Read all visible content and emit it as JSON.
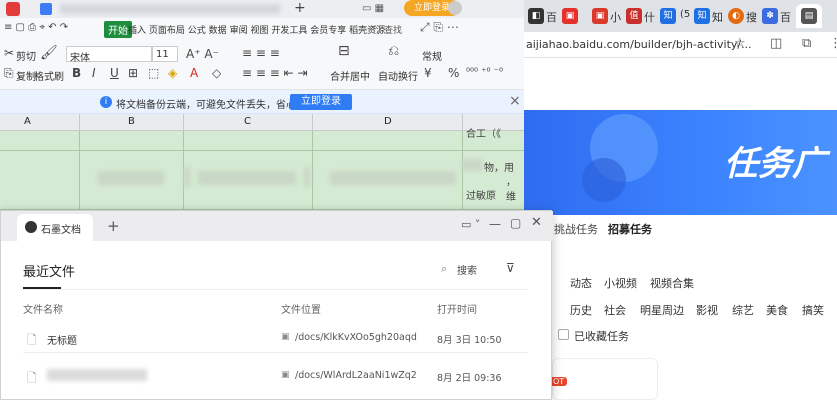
{
  "wps": {
    "tab_title_blurred": "",
    "add_tab": "+",
    "login_button": "立即登录",
    "menu": {
      "start_label": "开始",
      "items": [
        "插入",
        "页面布局",
        "公式",
        "数据",
        "审阅",
        "视图",
        "开发工具",
        "会员专享",
        "稻壳资源"
      ],
      "search_label": "查找"
    },
    "tools": {
      "cut": "剪切",
      "copy": "复制",
      "format_painter": "格式刷",
      "font_name": "宋体",
      "font_size": "11",
      "bold": "B",
      "italic": "I",
      "underline": "U",
      "merge_center": "合并居中",
      "wrap_text": "自动换行",
      "number_format": "常规",
      "currency": "¥",
      "percent": "%"
    },
    "notice": {
      "text": "将文档备份云端，可避免文件丢失，省心省事",
      "button": "立即登录",
      "close": "×"
    },
    "columns": [
      "A",
      "B",
      "C",
      "D"
    ],
    "cell_text": {
      "e1": "合工（《",
      "e2": "用",
      "e3": "，维",
      "e4": "过敏原",
      "e2b": "物，"
    }
  },
  "browser": {
    "tabs": [
      "百",
      "小",
      "什",
      "知",
      "搜",
      "百"
    ],
    "tab_colors": [
      "#e5312c",
      "#d93a2b",
      "#c62f2a",
      "#1f6fe5",
      "#e26b12",
      "#3d6be0"
    ],
    "url": "aijiahao.baidu.com/builder/bjh-activity/...",
    "banner_text": "任务广",
    "nav": [
      "挑战任务",
      "招募任务"
    ],
    "categories_row1": [
      "动态",
      "小视频",
      "视频合集"
    ],
    "categories_row2": [
      "历史",
      "社会",
      "明星周边",
      "影视",
      "综艺",
      "美食",
      "搞笑"
    ],
    "collected_label": "已收藏任务",
    "hot_badge": "OT"
  },
  "finder": {
    "app_title": "石墨文档",
    "add_tab": "+",
    "section_title": "最近文件",
    "search_label": "搜索",
    "columns": {
      "name": "文件名称",
      "location": "文件位置",
      "opened": "打开时间"
    },
    "rows": [
      {
        "name": "无标题",
        "location": "/docs/KlkKvXOo5gh20aqd",
        "time": "8月 3日 10:50"
      },
      {
        "name": "",
        "location": "/docs/WlArdL2aaNi1wZq2",
        "time": "8月 2日 09:36"
      }
    ]
  }
}
